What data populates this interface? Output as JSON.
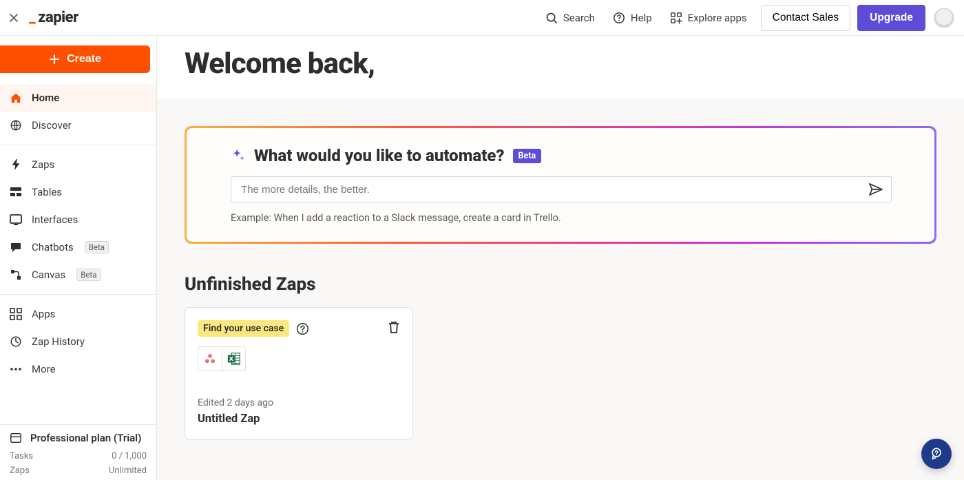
{
  "topbar": {
    "search_label": "Search",
    "help_label": "Help",
    "explore_label": "Explore apps",
    "contact_label": "Contact Sales",
    "upgrade_label": "Upgrade",
    "logo_text": "zapier"
  },
  "sidebar": {
    "create_label": "Create",
    "items": [
      {
        "label": "Home",
        "icon": "home-icon",
        "active": true
      },
      {
        "label": "Discover",
        "icon": "globe-icon"
      }
    ],
    "items2": [
      {
        "label": "Zaps",
        "icon": "bolt-icon"
      },
      {
        "label": "Tables",
        "icon": "tables-icon"
      },
      {
        "label": "Interfaces",
        "icon": "interfaces-icon"
      },
      {
        "label": "Chatbots",
        "icon": "chat-icon",
        "beta": "Beta"
      },
      {
        "label": "Canvas",
        "icon": "canvas-icon",
        "beta": "Beta"
      }
    ],
    "items3": [
      {
        "label": "Apps",
        "icon": "apps-icon"
      },
      {
        "label": "Zap History",
        "icon": "history-icon"
      },
      {
        "label": "More",
        "icon": "more-icon"
      }
    ],
    "plan_label": "Professional plan (Trial)",
    "tasks_label": "Tasks",
    "tasks_value": "0 / 1,000",
    "zaps_label": "Zaps",
    "zaps_value": "Unlimited"
  },
  "main": {
    "welcome": "Welcome back,",
    "prompt": {
      "title": "What would you like to automate?",
      "beta": "Beta",
      "placeholder": "The more details, the better.",
      "example": "Example: When I add a reaction to a Slack message, create a card in Trello."
    },
    "unfinished_title": "Unfinished Zaps",
    "zap_card": {
      "usecase": "Find your use case",
      "meta": "Edited 2 days ago",
      "name": "Untitled Zap"
    }
  }
}
